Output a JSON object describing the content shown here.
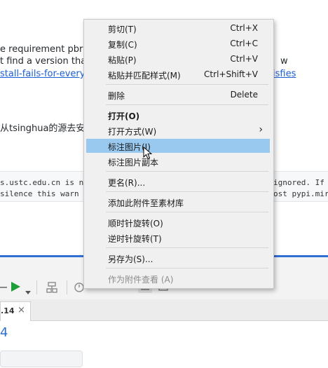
{
  "document": {
    "line1": "e requirement pbr (",
    "line2": "t find a version that",
    "line2_suffix": "w",
    "link1": "stall-fails-for-every-",
    "link1_suffix": "isfies",
    "line3": "从tsinghua的源去安装",
    "code_line1_left": "s.ustc.edu.cn is n",
    "code_line1_right": "ignored. If",
    "code_line2_left": " silence this warn",
    "code_line2_right": "ost pypi.mir"
  },
  "editor": {
    "tab_label": ".14",
    "tab_close": "×",
    "content_value": "4"
  },
  "context_menu": {
    "items": [
      {
        "label": "剪切(T)",
        "shortcut": "Ctrl+X"
      },
      {
        "label": "复制(C)",
        "shortcut": "Ctrl+C"
      },
      {
        "label": "粘贴(P)",
        "shortcut": "Ctrl+V"
      },
      {
        "label": "粘贴并匹配样式(M)",
        "shortcut": "Ctrl+Shift+V"
      },
      {
        "label": "删除",
        "shortcut": "Delete"
      },
      {
        "label": "打开(O)"
      },
      {
        "label": "打开方式(W)",
        "arrow": "›"
      },
      {
        "label": "标注图片(I)"
      },
      {
        "label": "标注图片副本"
      },
      {
        "label": "更名(R)..."
      },
      {
        "label": "添加此附件至素材库"
      },
      {
        "label": "顺时针旋转(O)"
      },
      {
        "label": "逆时针旋转(T)"
      },
      {
        "label": "另存为(S)..."
      },
      {
        "label": "作为附件查看 (A)"
      }
    ]
  },
  "colors": {
    "highlight": "#99c9ef",
    "link": "#1a5fd6",
    "accent_blue": "#2d6fd3",
    "run_green": "#1e9e3a"
  }
}
